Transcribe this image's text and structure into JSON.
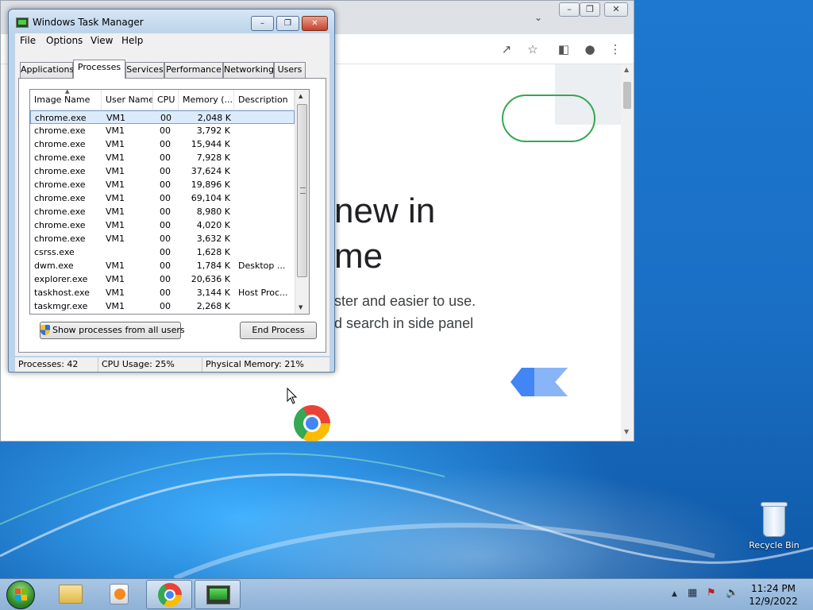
{
  "task_manager": {
    "title": "Windows Task Manager",
    "menu": [
      "File",
      "Options",
      "View",
      "Help"
    ],
    "tabs": [
      "Applications",
      "Processes",
      "Services",
      "Performance",
      "Networking",
      "Users"
    ],
    "active_tab": "Processes",
    "columns": [
      "Image Name",
      "User Name",
      "CPU",
      "Memory (...",
      "Description"
    ],
    "rows": [
      {
        "image": "chrome.exe",
        "user": "VM1",
        "cpu": "00",
        "memory": "2,048 K",
        "description": ""
      },
      {
        "image": "chrome.exe",
        "user": "VM1",
        "cpu": "00",
        "memory": "3,792 K",
        "description": ""
      },
      {
        "image": "chrome.exe",
        "user": "VM1",
        "cpu": "00",
        "memory": "15,944 K",
        "description": ""
      },
      {
        "image": "chrome.exe",
        "user": "VM1",
        "cpu": "00",
        "memory": "7,928 K",
        "description": ""
      },
      {
        "image": "chrome.exe",
        "user": "VM1",
        "cpu": "00",
        "memory": "37,624 K",
        "description": ""
      },
      {
        "image": "chrome.exe",
        "user": "VM1",
        "cpu": "00",
        "memory": "19,896 K",
        "description": ""
      },
      {
        "image": "chrome.exe",
        "user": "VM1",
        "cpu": "00",
        "memory": "69,104 K",
        "description": ""
      },
      {
        "image": "chrome.exe",
        "user": "VM1",
        "cpu": "00",
        "memory": "8,980 K",
        "description": ""
      },
      {
        "image": "chrome.exe",
        "user": "VM1",
        "cpu": "00",
        "memory": "4,020 K",
        "description": ""
      },
      {
        "image": "chrome.exe",
        "user": "VM1",
        "cpu": "00",
        "memory": "3,632 K",
        "description": ""
      },
      {
        "image": "csrss.exe",
        "user": "",
        "cpu": "00",
        "memory": "1,628 K",
        "description": ""
      },
      {
        "image": "dwm.exe",
        "user": "VM1",
        "cpu": "00",
        "memory": "1,784 K",
        "description": "Desktop ..."
      },
      {
        "image": "explorer.exe",
        "user": "VM1",
        "cpu": "00",
        "memory": "20,636 K",
        "description": ""
      },
      {
        "image": "taskhost.exe",
        "user": "VM1",
        "cpu": "00",
        "memory": "3,144 K",
        "description": "Host Proc..."
      },
      {
        "image": "taskmgr.exe",
        "user": "VM1",
        "cpu": "00",
        "memory": "2,268 K",
        "description": ""
      }
    ],
    "show_all_label": "Show processes from all users",
    "end_process_label": "End Process",
    "status": {
      "processes": "Processes: 42",
      "cpu_usage": "CPU Usage: 25%",
      "physical_memory": "Physical Memory: 21%"
    }
  },
  "chrome": {
    "page_text": {
      "line1": "new in",
      "line2": "me",
      "line3": "ster and easier to use.",
      "line4": "d search in side panel"
    },
    "toolbar_icons": [
      "share-icon",
      "star-icon",
      "side-panel-icon",
      "profile-icon",
      "menu-icon"
    ],
    "colors": {
      "green_outline": "#34a853",
      "arrow_blue": "#4285f4"
    }
  },
  "desktop": {
    "recycle_bin_label": "Recycle Bin"
  },
  "taskbar": {
    "pinned": [
      "windows-explorer",
      "media-player",
      "google-chrome",
      "task-manager"
    ],
    "time": "11:24 PM",
    "date": "12/9/2022"
  }
}
